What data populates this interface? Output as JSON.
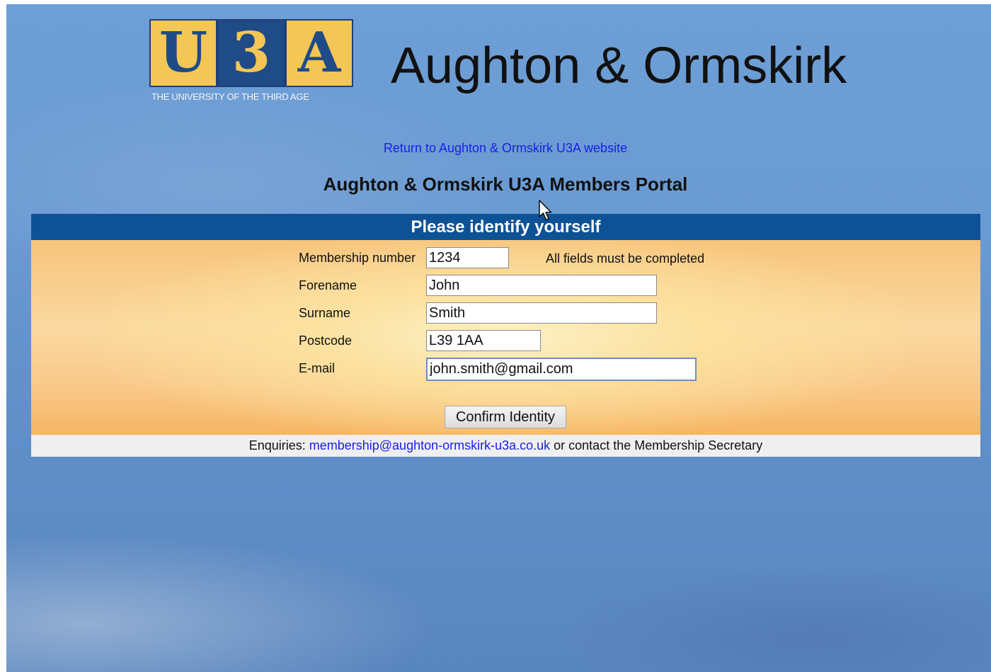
{
  "logo": {
    "letters": [
      "U",
      "3",
      "A"
    ],
    "tagline": "THE UNIVERSITY OF THE THIRD AGE"
  },
  "site_title": "Aughton & Ormskirk",
  "return_link": "Return to Aughton & Ormskirk U3A website",
  "portal_title": "Aughton & Ormskirk U3A Members Portal",
  "panel": {
    "header": "Please identify yourself",
    "required_note": "All fields must be completed",
    "fields": {
      "membership": {
        "label": "Membership number",
        "value": "1234"
      },
      "forename": {
        "label": "Forename",
        "value": "John"
      },
      "surname": {
        "label": "Surname",
        "value": "Smith"
      },
      "postcode": {
        "label": "Postcode",
        "value": "L39 1AA"
      },
      "email": {
        "label": "E-mail",
        "value": "john.smith@gmail.com"
      }
    },
    "confirm_label": "Confirm Identity"
  },
  "footer": {
    "prefix": "Enquiries: ",
    "email": "membership@aughton-ormskirk-u3a.co.uk",
    "suffix": " or contact the Membership Secretary"
  },
  "colors": {
    "header_bar": "#0e5296",
    "link": "#1a20e6",
    "logo_blue": "#1f4b86",
    "logo_gold": "#f3c655"
  },
  "icons": {
    "cursor": "mouse-pointer-icon"
  }
}
